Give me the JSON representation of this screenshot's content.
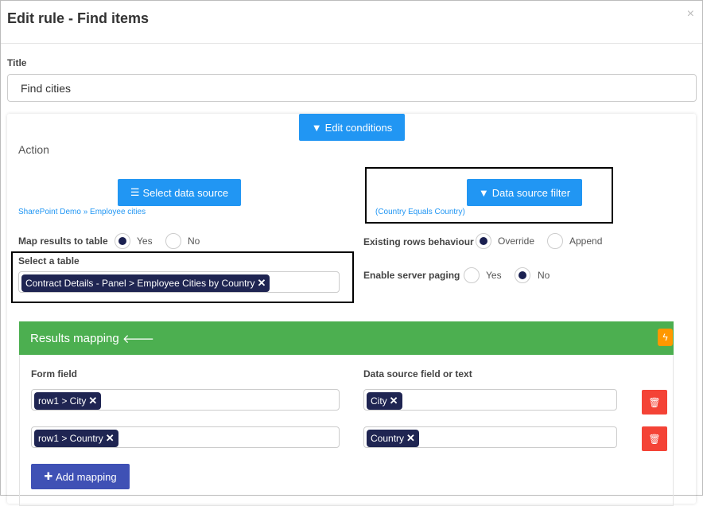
{
  "dialog": {
    "title": "Edit rule - Find items",
    "close_icon": "×"
  },
  "title_field": {
    "label": "Title",
    "value": "Find cities"
  },
  "edit_conditions": "Edit conditions",
  "action_label": "Action",
  "select_data_source": {
    "label": "Select data source",
    "path": "SharePoint Demo » Employee cities"
  },
  "data_source_filter": {
    "label": "Data source filter",
    "summary": "(Country Equals Country)"
  },
  "map_results": {
    "label": "Map results to table",
    "options": [
      "Yes",
      "No"
    ],
    "selected": "Yes"
  },
  "select_table": {
    "label": "Select a table",
    "value": "Contract Details - Panel > Employee Cities by Country"
  },
  "existing_rows": {
    "label": "Existing rows behaviour",
    "options": [
      "Override",
      "Append"
    ],
    "selected": "Override"
  },
  "server_paging": {
    "label": "Enable server paging",
    "options": [
      "Yes",
      "No"
    ],
    "selected": "No"
  },
  "results_mapping": {
    "title": "Results mapping",
    "form_field_header": "Form field",
    "source_header": "Data source field or text",
    "rows": [
      {
        "form": "row1 > City",
        "source": "City"
      },
      {
        "form": "row1 > Country",
        "source": "Country"
      }
    ],
    "add_label": "Add mapping"
  },
  "colors": {
    "primary": "#2196f3",
    "green": "#4caf50",
    "danger": "#f44336",
    "indigo": "#3f51b5",
    "tag": "#1f2552",
    "warning": "#ff9800"
  }
}
